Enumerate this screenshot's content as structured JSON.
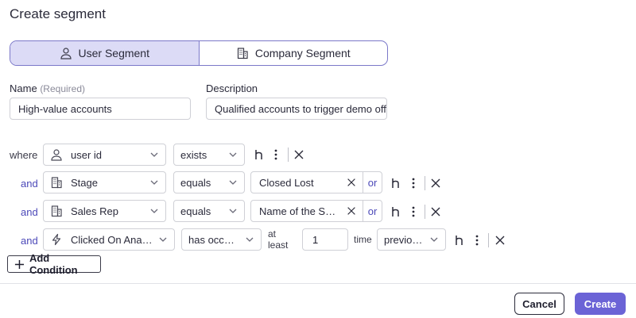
{
  "dialog": {
    "title": "Create segment"
  },
  "segment_type": {
    "options": [
      {
        "label": "User Segment",
        "icon": "user-icon",
        "selected": true
      },
      {
        "label": "Company Segment",
        "icon": "building-icon",
        "selected": false
      }
    ]
  },
  "form": {
    "name_label": "Name",
    "name_required": "(Required)",
    "name_value": "High-value accounts",
    "description_label": "Description",
    "description_value": "Qualified accounts to trigger demo offe"
  },
  "conditions": [
    {
      "connector": "where",
      "property": "user id",
      "property_icon": "user-icon",
      "operator": "exists"
    },
    {
      "connector": "and",
      "property": "Stage",
      "property_icon": "building-icon",
      "operator": "equals",
      "value": "Closed Lost",
      "or_label": "or"
    },
    {
      "connector": "and",
      "property": "Sales Rep",
      "property_icon": "building-icon",
      "operator": "equals",
      "value": "Name of the Sale...",
      "or_label": "or"
    },
    {
      "connector": "and",
      "property": "Clicked On Analytics",
      "property_icon": "lightning-icon",
      "operator": "has occurred",
      "at_least_label": "at least",
      "count": "1",
      "time_label": "time",
      "timeframe": "previously"
    }
  ],
  "add_condition_label": "Add Condition",
  "footer": {
    "cancel_label": "Cancel",
    "create_label": "Create"
  },
  "colors": {
    "accent": "#6b63d6",
    "toggle_active": "#dcdbf6",
    "connector": "#4b48b8"
  }
}
